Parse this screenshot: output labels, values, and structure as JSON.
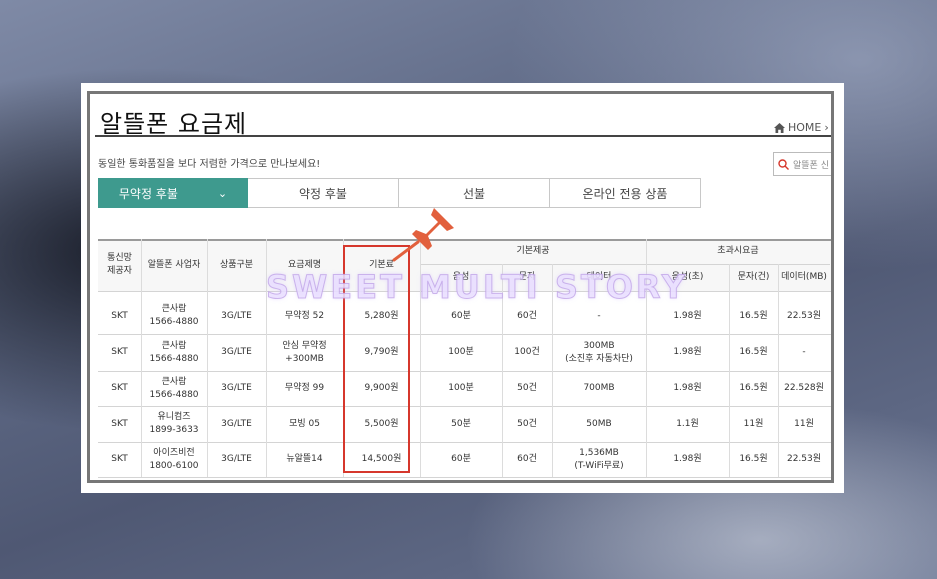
{
  "page": {
    "title": "알뜰폰 요금제",
    "home_label": "HOME",
    "home_chevron": "›",
    "subtitle": "동일한 통화품질을 보다 저렴한 가격으로 만나보세요!",
    "search_placeholder": "알뜰폰 신"
  },
  "tabs": [
    {
      "label": "무약정 후불",
      "active": true
    },
    {
      "label": "약정 후불"
    },
    {
      "label": "선불"
    },
    {
      "label": "온라인 전용 상품"
    }
  ],
  "tab_chevron": "⌄",
  "table": {
    "headers": {
      "carrier": "통신망\n제공자",
      "operator": "알뜰폰 사업자",
      "network": "상품구분",
      "plan": "요금제명",
      "base_fee": "기본료",
      "included": "기본제공",
      "included_voice": "음성",
      "included_sms": "문자",
      "included_data": "데이터",
      "overage": "초과시요금",
      "over_voice": "음성(초)",
      "over_sms": "문자(건)",
      "over_data": "데이터(MB)"
    },
    "rows": [
      [
        "SKT",
        "큰사람\n1566-4880",
        "3G/LTE",
        "무약정 52",
        "5,280원",
        "60분",
        "60건",
        "-",
        "1.98원",
        "16.5원",
        "22.53원"
      ],
      [
        "SKT",
        "큰사람\n1566-4880",
        "3G/LTE",
        "안심 무약정\n+300MB",
        "9,790원",
        "100분",
        "100건",
        "300MB\n(소진후 자동차단)",
        "1.98원",
        "16.5원",
        "-"
      ],
      [
        "SKT",
        "큰사람\n1566-4880",
        "3G/LTE",
        "무약정 99",
        "9,900원",
        "100분",
        "50건",
        "700MB",
        "1.98원",
        "16.5원",
        "22.528원"
      ],
      [
        "SKT",
        "유니컴즈\n1899-3633",
        "3G/LTE",
        "모빙 05",
        "5,500원",
        "50분",
        "50건",
        "50MB",
        "1.1원",
        "11원",
        "11원"
      ],
      [
        "SKT",
        "아이즈비전\n1800-6100",
        "3G/LTE",
        "뉴알뜰14",
        "14,500원",
        "60분",
        "60건",
        "1,536MB\n(T-WiFi무료)",
        "1.98원",
        "16.5원",
        "22.53원"
      ]
    ]
  },
  "watermark": "SWEET MULTI STORY",
  "colors": {
    "active_tab": "#3e9a8e",
    "highlight": "#d6372c",
    "pin": "#e2603d"
  }
}
